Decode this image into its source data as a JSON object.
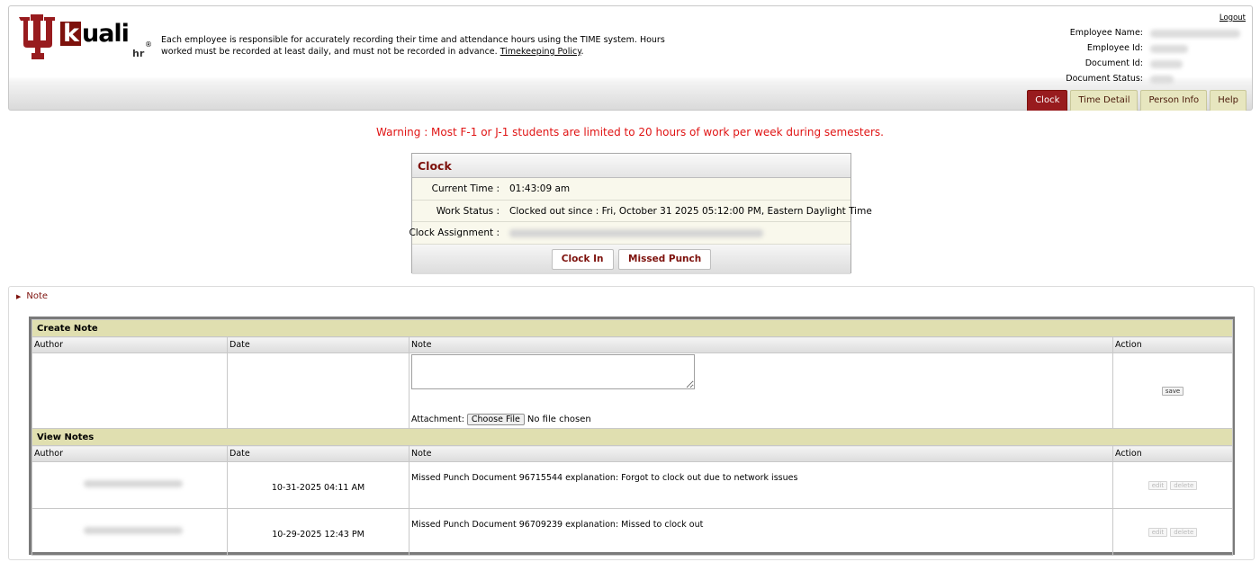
{
  "brand": {
    "trident_color": "#981b1e",
    "word_k": "k",
    "word_rest": "uali",
    "sub": "hr",
    "reg": "®"
  },
  "policy": {
    "text": "Each employee is responsible for accurately recording their time and attendance hours using the TIME system. Hours worked must be recorded at least daily, and must not be recorded in advance. ",
    "link": "Timekeeping Policy",
    "tail": "."
  },
  "header": {
    "logout": "Logout",
    "employee_name_label": "Employee Name:",
    "employee_id_label": "Employee Id:",
    "document_id_label": "Document Id:",
    "document_status_label": "Document Status:"
  },
  "tabs": [
    {
      "label": "Clock",
      "active": true
    },
    {
      "label": "Time Detail",
      "active": false
    },
    {
      "label": "Person Info",
      "active": false
    },
    {
      "label": "Help",
      "active": false
    }
  ],
  "warning": "Warning : Most F-1 or J-1 students are limited to 20 hours of work per week during semesters.",
  "clock": {
    "title": "Clock",
    "current_time_label": "Current Time :",
    "current_time": "01:43:09 am",
    "work_status_label": "Work Status :",
    "work_status": "Clocked out since : Fri, October 31 2025 05:12:00 PM, Eastern Daylight Time",
    "assignment_label": "Clock Assignment :",
    "clock_in": "Clock In",
    "missed_punch": "Missed Punch"
  },
  "note": {
    "section_label": "Note",
    "create_band": "Create Note",
    "view_band": "View Notes",
    "columns": [
      "Author",
      "Date",
      "Note",
      "Action"
    ],
    "attachment_label": "Attachment:",
    "choose_file": "Choose File",
    "no_file": "No file chosen",
    "save": "save",
    "edit": "edit",
    "delete": "delete",
    "rows": [
      {
        "date": "10-31-2025 04:11 AM",
        "note": "Missed Punch Document 96715544 explanation: Forgot to clock out due to network issues"
      },
      {
        "date": "10-29-2025 12:43 PM",
        "note": "Missed Punch Document 96709239 explanation: Missed to clock out"
      }
    ]
  }
}
